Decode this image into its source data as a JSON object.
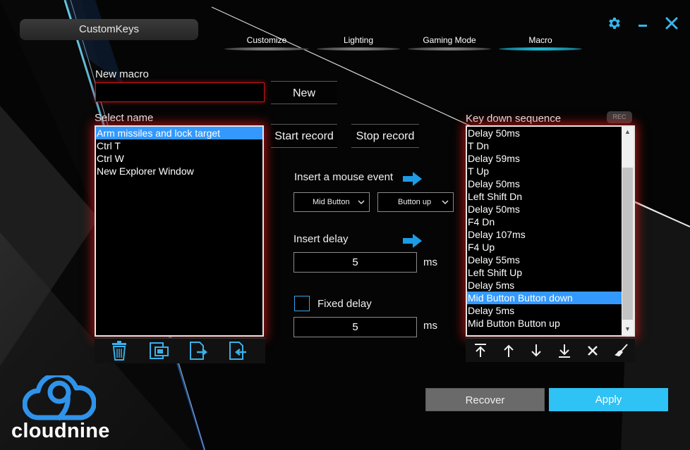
{
  "app": {
    "title": "CustomKeys",
    "brand_logo_text": "cloudnine"
  },
  "tabs": [
    {
      "label": "Customize",
      "active": false
    },
    {
      "label": "Lighting",
      "active": false
    },
    {
      "label": "Gaming Mode",
      "active": false
    },
    {
      "label": "Macro",
      "active": true
    }
  ],
  "window_controls": {
    "settings_icon": "gear-icon",
    "minimize_icon": "minimize-icon",
    "close_icon": "close-icon"
  },
  "new_macro": {
    "label": "New macro",
    "input_value": "",
    "button": "New"
  },
  "select_name": {
    "label": "Select name",
    "items": [
      "Arm missiles and lock target",
      "Ctrl T",
      "Ctrl W",
      "New Explorer Window"
    ],
    "selected_index": 0
  },
  "record": {
    "start": "Start record",
    "stop": "Stop record"
  },
  "mouse_event": {
    "label": "Insert a mouse event",
    "button_select": "Mid Button",
    "action_select": "Button up"
  },
  "delay": {
    "label": "Insert delay",
    "value": "5",
    "unit": "ms"
  },
  "fixed_delay": {
    "label": "Fixed delay",
    "checked": false,
    "value": "5",
    "unit": "ms"
  },
  "macro_tools": [
    "trash-icon",
    "copy-icon",
    "export-icon",
    "import-icon"
  ],
  "sequence": {
    "label": "Key down sequence",
    "rec_badge": "REC",
    "items": [
      "Delay 50ms",
      "T Dn",
      "Delay 59ms",
      "T Up",
      "Delay 50ms",
      "Left Shift Dn",
      "Delay 50ms",
      "F4 Dn",
      "Delay 107ms",
      "F4 Up",
      "Delay 55ms",
      "Left Shift Up",
      "Delay 5ms",
      "Mid Button Button down",
      "Delay 5ms",
      "Mid Button Button up"
    ],
    "selected_index": 13
  },
  "sequence_tools": [
    "move-top-icon",
    "move-up-icon",
    "move-down-icon",
    "move-bottom-icon",
    "delete-icon",
    "clear-icon"
  ],
  "footer": {
    "recover": "Recover",
    "apply": "Apply"
  },
  "colors": {
    "accent": "#2fc2f4",
    "selection": "#3399ff",
    "glow": "#d71919",
    "icon_blue": "#35b6ee"
  }
}
